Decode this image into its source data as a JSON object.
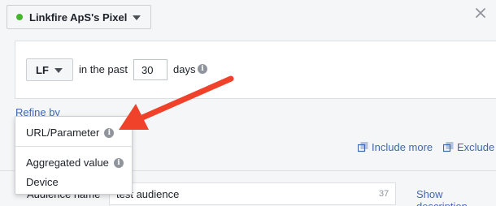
{
  "pixel_selector": {
    "label": "Linkfire ApS's Pixel",
    "status_color": "#42b72a"
  },
  "rule": {
    "source_select": "LF",
    "in_the_past_text": "in the past",
    "days_value": "30",
    "days_label": "days"
  },
  "refine_by": "Refine by",
  "dropdown": {
    "items": [
      {
        "label": "URL/Parameter"
      },
      {
        "label": "Aggregated value"
      },
      {
        "label": "Device"
      }
    ]
  },
  "actions": {
    "include_more": "Include more",
    "exclude": "Exclude"
  },
  "audience_name": {
    "label": "Audience name",
    "value": "test audience",
    "remaining_chars": "37",
    "show_description": "Show description"
  },
  "annotation": {
    "arrow_color": "#f0412b"
  },
  "colors": {
    "link": "#4267b2",
    "panel_bg": "#f5f6f7",
    "border": "#dddfe2"
  }
}
